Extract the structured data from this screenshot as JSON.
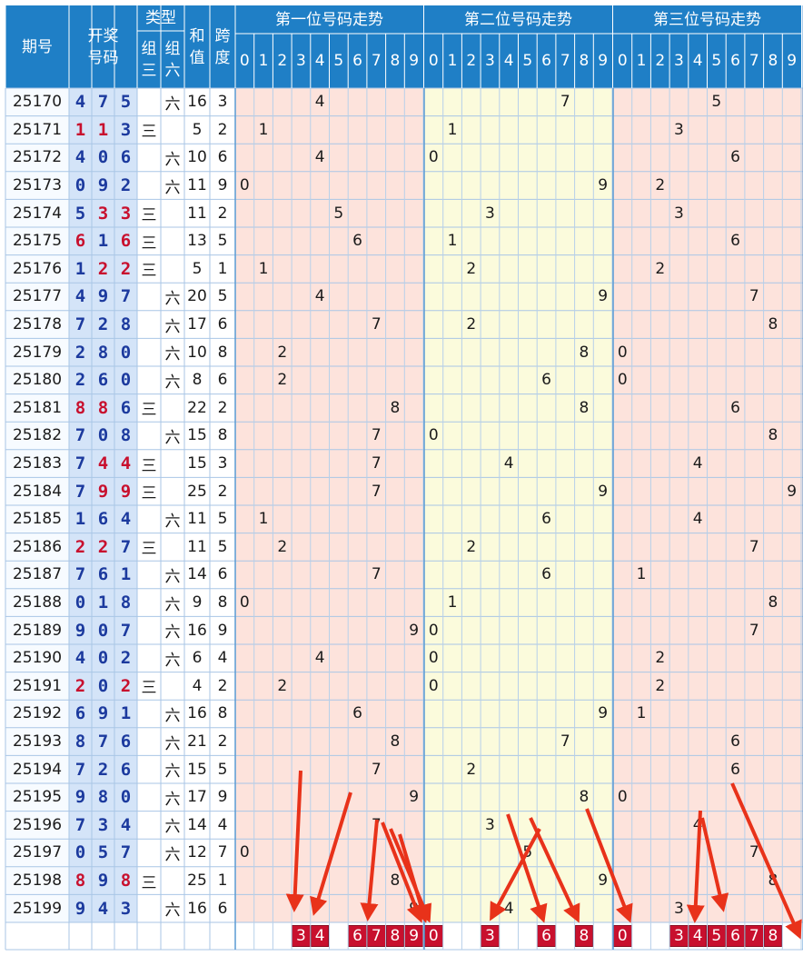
{
  "header": {
    "period": "期号",
    "draw": "开奖\n号码",
    "type": "类型",
    "type_z3": "组\n三",
    "type_z6": "组\n六",
    "sum": "和\n值",
    "span": "跨\n度",
    "pos1": "第一位号码走势",
    "pos2": "第二位号码走势",
    "pos3": "第三位号码走势",
    "digits": [
      "0",
      "1",
      "2",
      "3",
      "4",
      "5",
      "6",
      "7",
      "8",
      "9"
    ]
  },
  "chart_data": {
    "type": "table",
    "columns": [
      "期号",
      "开奖号码",
      "类型",
      "和值",
      "跨度",
      "第一位号码走势",
      "第二位号码走势",
      "第三位号码走势"
    ],
    "rows": [
      {
        "period": "25170",
        "digits": [
          4,
          7,
          5
        ],
        "kind": "六",
        "sum": 16,
        "span": 3
      },
      {
        "period": "25171",
        "digits": [
          1,
          1,
          3
        ],
        "kind": "三",
        "sum": 5,
        "span": 2
      },
      {
        "period": "25172",
        "digits": [
          4,
          0,
          6
        ],
        "kind": "六",
        "sum": 10,
        "span": 6
      },
      {
        "period": "25173",
        "digits": [
          0,
          9,
          2
        ],
        "kind": "六",
        "sum": 11,
        "span": 9
      },
      {
        "period": "25174",
        "digits": [
          5,
          3,
          3
        ],
        "kind": "三",
        "sum": 11,
        "span": 2
      },
      {
        "period": "25175",
        "digits": [
          6,
          1,
          6
        ],
        "kind": "三",
        "sum": 13,
        "span": 5
      },
      {
        "period": "25176",
        "digits": [
          1,
          2,
          2
        ],
        "kind": "三",
        "sum": 5,
        "span": 1
      },
      {
        "period": "25177",
        "digits": [
          4,
          9,
          7
        ],
        "kind": "六",
        "sum": 20,
        "span": 5
      },
      {
        "period": "25178",
        "digits": [
          7,
          2,
          8
        ],
        "kind": "六",
        "sum": 17,
        "span": 6
      },
      {
        "period": "25179",
        "digits": [
          2,
          8,
          0
        ],
        "kind": "六",
        "sum": 10,
        "span": 8
      },
      {
        "period": "25180",
        "digits": [
          2,
          6,
          0
        ],
        "kind": "六",
        "sum": 8,
        "span": 6
      },
      {
        "period": "25181",
        "digits": [
          8,
          8,
          6
        ],
        "kind": "三",
        "sum": 22,
        "span": 2
      },
      {
        "period": "25182",
        "digits": [
          7,
          0,
          8
        ],
        "kind": "六",
        "sum": 15,
        "span": 8
      },
      {
        "period": "25183",
        "digits": [
          7,
          4,
          4
        ],
        "kind": "三",
        "sum": 15,
        "span": 3
      },
      {
        "period": "25184",
        "digits": [
          7,
          9,
          9
        ],
        "kind": "三",
        "sum": 25,
        "span": 2
      },
      {
        "period": "25185",
        "digits": [
          1,
          6,
          4
        ],
        "kind": "六",
        "sum": 11,
        "span": 5
      },
      {
        "period": "25186",
        "digits": [
          2,
          2,
          7
        ],
        "kind": "三",
        "sum": 11,
        "span": 5
      },
      {
        "period": "25187",
        "digits": [
          7,
          6,
          1
        ],
        "kind": "六",
        "sum": 14,
        "span": 6
      },
      {
        "period": "25188",
        "digits": [
          0,
          1,
          8
        ],
        "kind": "六",
        "sum": 9,
        "span": 8
      },
      {
        "period": "25189",
        "digits": [
          9,
          0,
          7
        ],
        "kind": "六",
        "sum": 16,
        "span": 9
      },
      {
        "period": "25190",
        "digits": [
          4,
          0,
          2
        ],
        "kind": "六",
        "sum": 6,
        "span": 4
      },
      {
        "period": "25191",
        "digits": [
          2,
          0,
          2
        ],
        "kind": "三",
        "sum": 4,
        "span": 2
      },
      {
        "period": "25192",
        "digits": [
          6,
          9,
          1
        ],
        "kind": "六",
        "sum": 16,
        "span": 8
      },
      {
        "period": "25193",
        "digits": [
          8,
          7,
          6
        ],
        "kind": "六",
        "sum": 21,
        "span": 2
      },
      {
        "period": "25194",
        "digits": [
          7,
          2,
          6
        ],
        "kind": "六",
        "sum": 15,
        "span": 5
      },
      {
        "period": "25195",
        "digits": [
          9,
          8,
          0
        ],
        "kind": "六",
        "sum": 17,
        "span": 9
      },
      {
        "period": "25196",
        "digits": [
          7,
          3,
          4
        ],
        "kind": "六",
        "sum": 14,
        "span": 4
      },
      {
        "period": "25197",
        "digits": [
          0,
          5,
          7
        ],
        "kind": "六",
        "sum": 12,
        "span": 7
      },
      {
        "period": "25198",
        "digits": [
          8,
          9,
          8
        ],
        "kind": "三",
        "sum": 25,
        "span": 1
      },
      {
        "period": "25199",
        "digits": [
          9,
          4,
          3
        ],
        "kind": "六",
        "sum": 16,
        "span": 6
      }
    ],
    "marked_picks": [
      [
        3,
        4,
        6,
        7,
        8,
        9
      ],
      [
        0,
        3,
        6,
        8
      ],
      [
        0,
        3,
        4,
        5,
        6,
        7,
        8
      ]
    ],
    "colors": {
      "header": "#1f7fc6",
      "pos1_bg": "#fde3dc",
      "pos2_bg": "#fbfbdc",
      "pos3_bg": "#fde3dc",
      "draw_blue": "#1c3a9e",
      "draw_red": "#c8102e",
      "mark": "#c8102e",
      "arrow": "#e8321a"
    }
  }
}
